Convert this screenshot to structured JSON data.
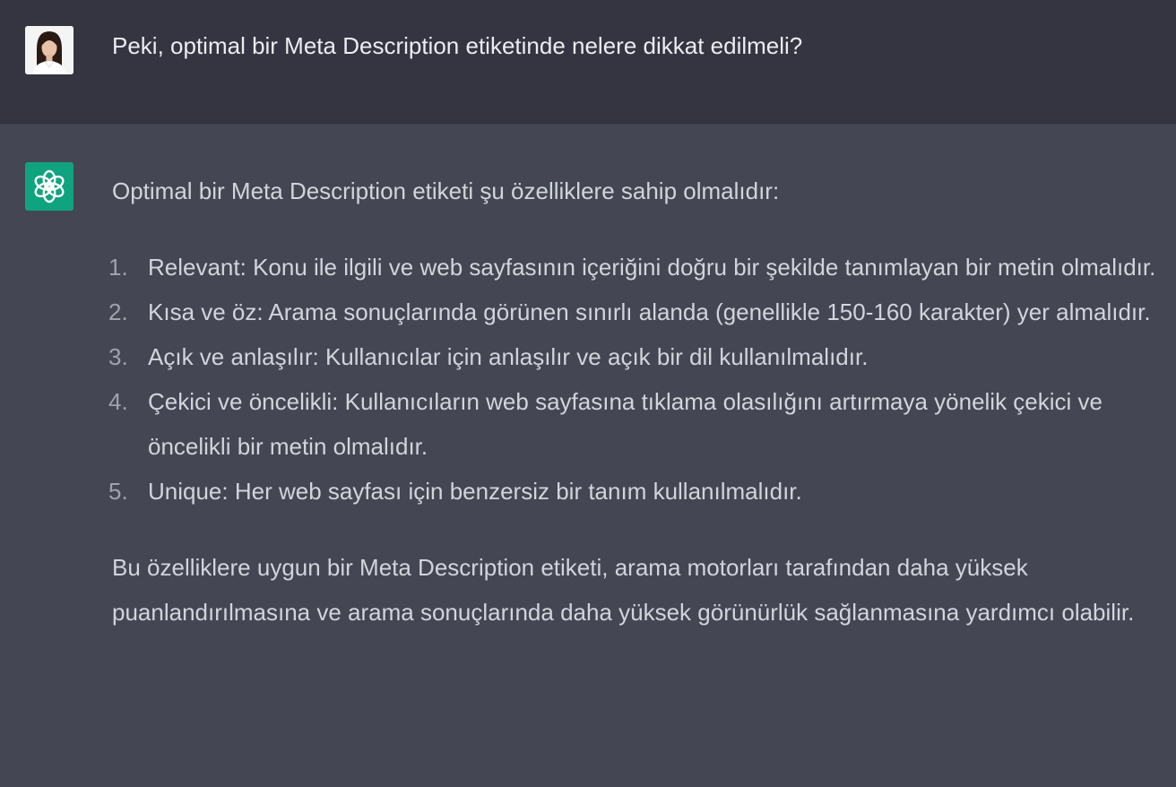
{
  "user_message": {
    "text": "Peki, optimal bir Meta Description etiketinde nelere dikkat edilmeli?"
  },
  "assistant_message": {
    "intro": "Optimal bir Meta Description etiketi şu özelliklere sahip olmalıdır:",
    "items": [
      {
        "number": "1.",
        "text": "Relevant: Konu ile ilgili ve web sayfasının içeriğini doğru bir şekilde tanımlayan bir metin olmalıdır."
      },
      {
        "number": "2.",
        "text": "Kısa ve öz: Arama sonuçlarında görünen sınırlı alanda (genellikle 150-160 karakter) yer almalıdır."
      },
      {
        "number": "3.",
        "text": "Açık ve anlaşılır: Kullanıcılar için anlaşılır ve açık bir dil kullanılmalıdır."
      },
      {
        "number": "4.",
        "text": "Çekici ve öncelikli: Kullanıcıların web sayfasına tıklama olasılığını artırmaya yönelik çekici ve öncelikli bir metin olmalıdır."
      },
      {
        "number": "5.",
        "text": "Unique: Her web sayfası için benzersiz bir tanım kullanılmalıdır."
      }
    ],
    "outro": "Bu özelliklere uygun bir Meta Description etiketi, arama motorları tarafından daha yüksek puanlandırılmasına ve arama sonuçlarında daha yüksek görünürlük sağlanmasına yardımcı olabilir."
  },
  "colors": {
    "user_bg": "#343541",
    "assistant_bg": "#444654",
    "assistant_icon_bg": "#10a37f",
    "text": "#d1d5db"
  },
  "icons": {
    "user_avatar": "user-photo-avatar",
    "assistant_avatar": "openai-logo-icon"
  }
}
